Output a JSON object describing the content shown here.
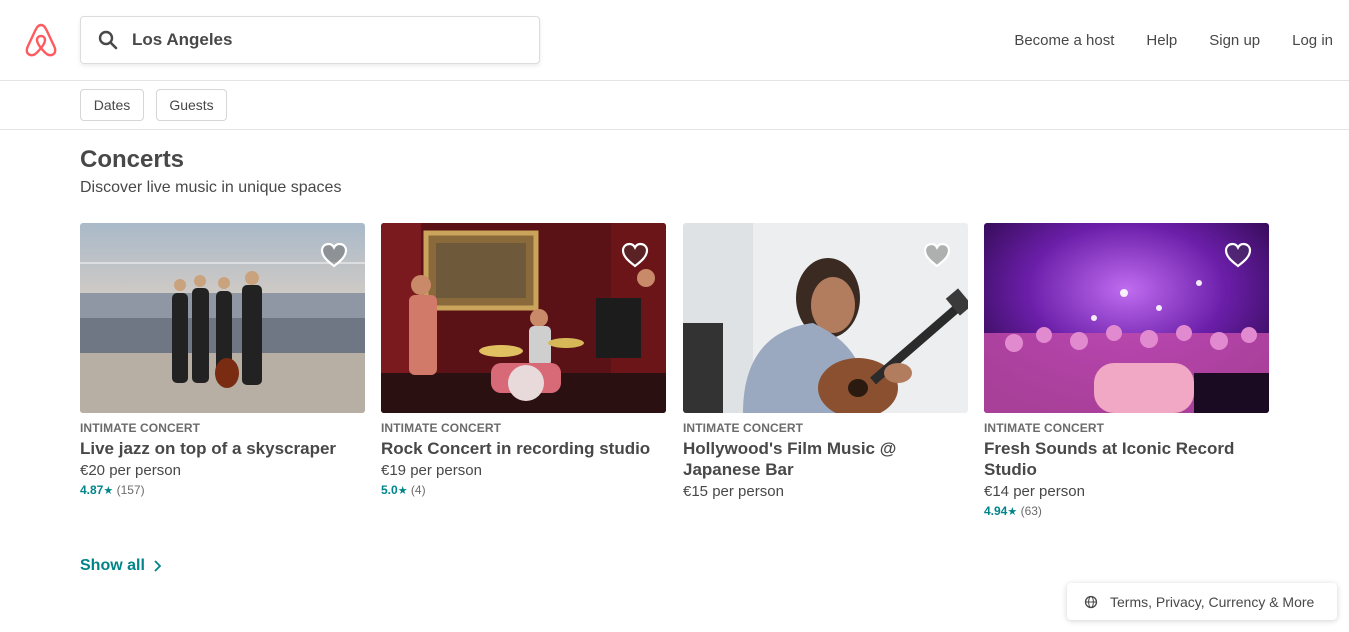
{
  "header": {
    "logo_icon": "airbnb-logo-icon",
    "search": {
      "icon": "search-icon",
      "value": "Los Angeles"
    },
    "nav": [
      "Become a host",
      "Help",
      "Sign up",
      "Log in"
    ]
  },
  "filters": [
    "Dates",
    "Guests"
  ],
  "section": {
    "title": "Concerts",
    "subtitle": "Discover live music in unique spaces"
  },
  "cards": [
    {
      "kicker": "INTIMATE CONCERT",
      "title": "Live jazz on top of a skyscraper",
      "price": "€20 per person",
      "rating": "4.87",
      "reviews": "(157)"
    },
    {
      "kicker": "INTIMATE CONCERT",
      "title": "Rock Concert in recording studio",
      "price": "€19 per person",
      "rating": "5.0",
      "reviews": "(4)"
    },
    {
      "kicker": "INTIMATE CONCERT",
      "title": "Hollywood's Film Music @ Japanese Bar",
      "price": "€15 per person"
    },
    {
      "kicker": "INTIMATE CONCERT",
      "title": "Fresh Sounds at Iconic Record Studio",
      "price": "€14 per person",
      "rating": "4.94",
      "reviews": "(63)"
    }
  ],
  "show_all": "Show all",
  "footer": {
    "label": "Terms, Privacy, Currency & More",
    "icon": "globe-icon"
  },
  "colors": {
    "brand": "#FF5A5F",
    "accent": "#008489",
    "text": "#484848"
  }
}
